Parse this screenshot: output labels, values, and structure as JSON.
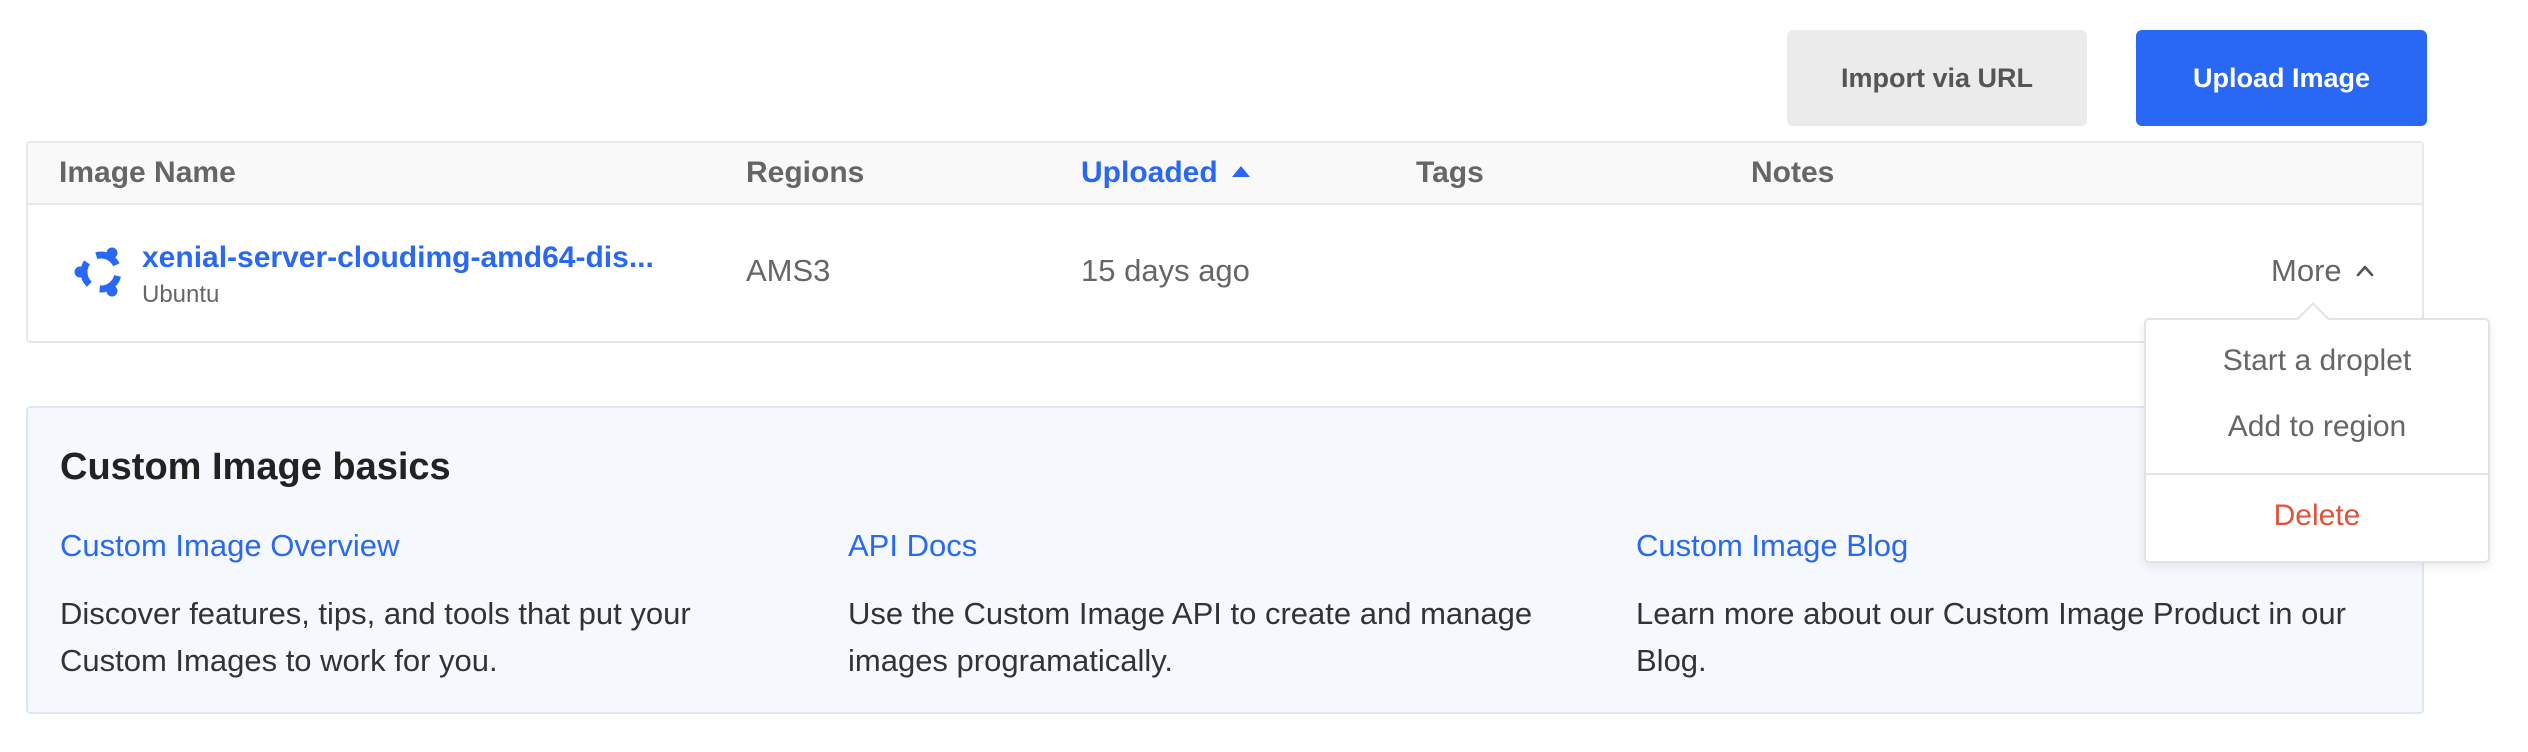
{
  "actions": {
    "import_label": "Import via URL",
    "upload_label": "Upload Image"
  },
  "table": {
    "headers": {
      "image_name": "Image Name",
      "regions": "Regions",
      "uploaded": "Uploaded",
      "tags": "Tags",
      "notes": "Notes"
    },
    "sorted_column": "uploaded",
    "sort_direction": "ascending",
    "rows": [
      {
        "name": "xenial-server-cloudimg-amd64-dis...",
        "distribution": "Ubuntu",
        "os_icon": "ubuntu-logo-icon",
        "region": "AMS3",
        "uploaded": "15 days ago",
        "tags": "",
        "notes": "",
        "more_label": "More"
      }
    ]
  },
  "dropdown": {
    "items": [
      {
        "label": "Start a droplet"
      },
      {
        "label": "Add to region"
      },
      {
        "label": "Delete"
      }
    ]
  },
  "basics": {
    "title": "Custom Image basics",
    "columns": [
      {
        "link": "Custom Image Overview",
        "description": "Discover features, tips, and tools that put your Custom Images to work for you."
      },
      {
        "link": "API Docs",
        "description": "Use the Custom Image API to create and manage images programatically."
      },
      {
        "link": "Custom Image Blog",
        "description": "Learn more about our Custom Image Product in our Blog."
      }
    ]
  },
  "colors": {
    "primary": "#2968f5",
    "danger": "#e0533a",
    "panel_background": "#f5f9fd"
  }
}
